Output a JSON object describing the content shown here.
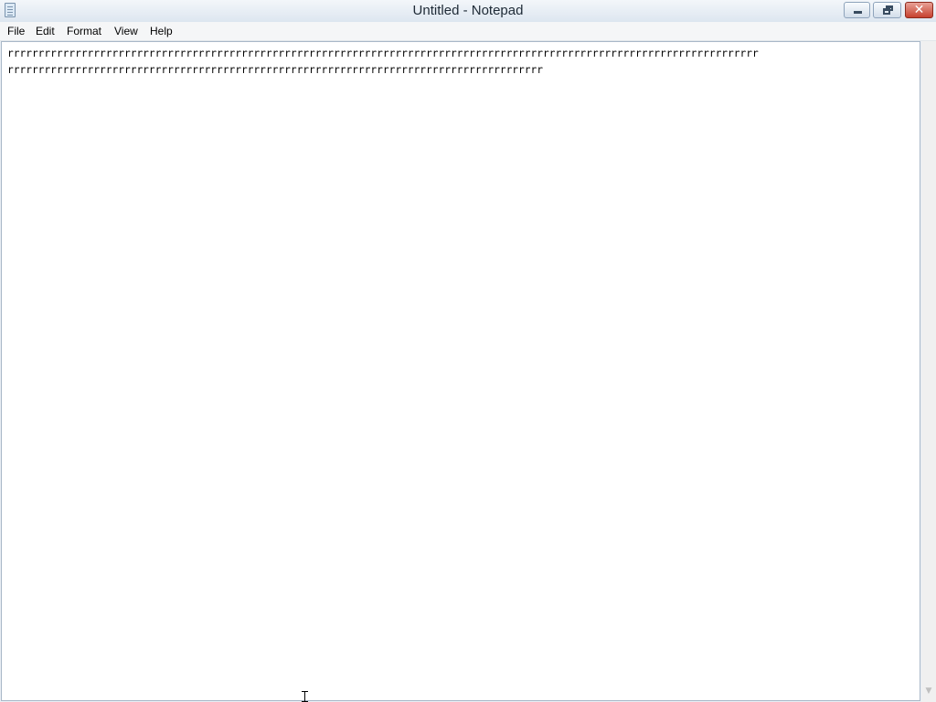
{
  "window": {
    "title": "Untitled - Notepad",
    "icon": "notepad-icon",
    "controls": {
      "minimize_icon": "minimize-icon",
      "restore_icon": "restore-icon",
      "close_label": "✕",
      "close_color": "#c6412f"
    }
  },
  "menu": {
    "file": "File",
    "edit": "Edit",
    "format": "Format",
    "view": "View",
    "help": "Help"
  },
  "editor": {
    "line1": "rrrrrrrrrrrrrrrrrrrrrrrrrrrrrrrrrrrrrrrrrrrrrrrrrrrrrrrrrrrrrrrrrrrrrrrrrrrrrrrrrrrrrrrrrrrrrrrrrrrrrrrrrrrrrrrrrrrrrrrrrr",
    "line2": "rrrrrrrrrrrrrrrrrrrrrrrrrrrrrrrrrrrrrrrrrrrrrrrrrrrrrrrrrrrrrrrrrrrrrrrrrrrrrrrrrrrrrrr"
  },
  "scrollbar": {
    "down_arrow_icon": "chevron-down-icon",
    "down_arrow_glyph": "▼"
  }
}
